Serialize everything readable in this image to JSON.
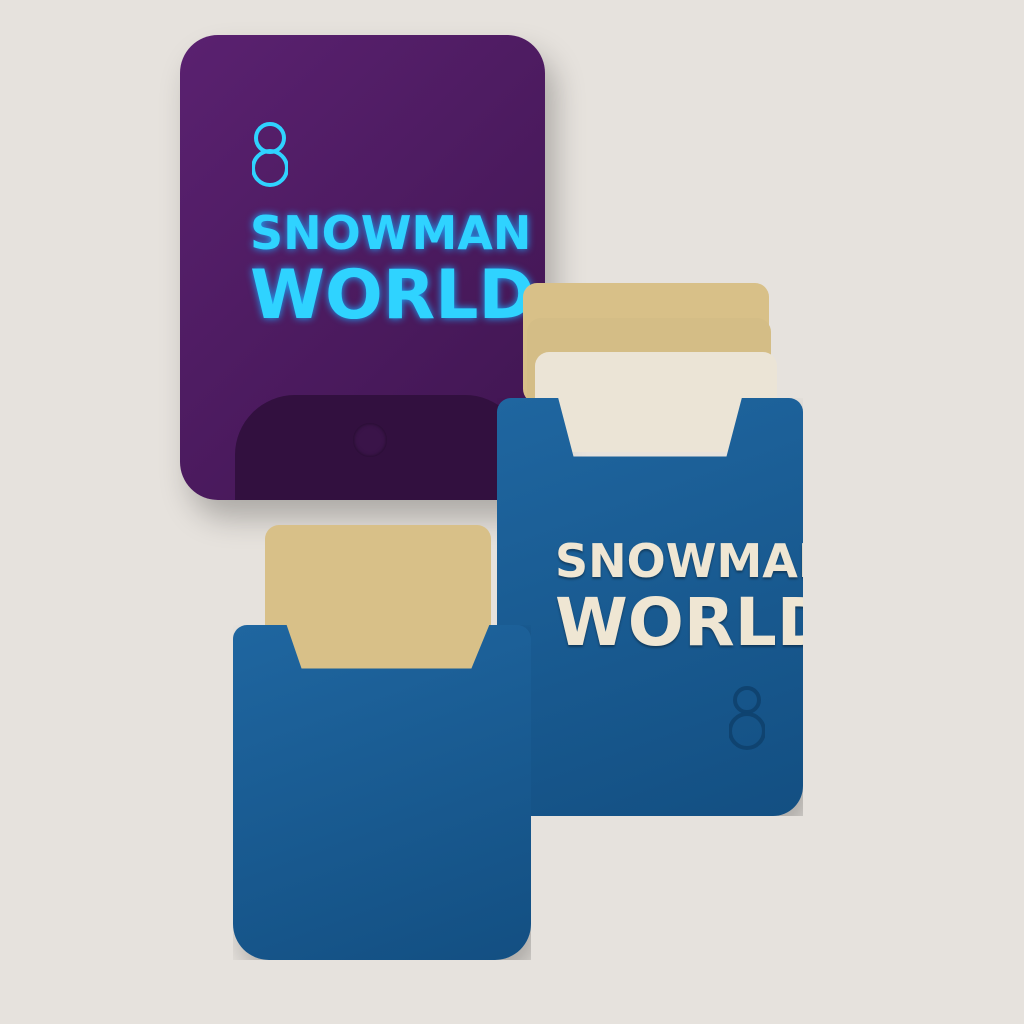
{
  "purple_box": {
    "title_line1": "SNOWMAN",
    "title_line2": "WORLD",
    "icon": "snowman-icon",
    "color": "#4a1a5e",
    "text_color": "#2fd3ff"
  },
  "blue_box_right": {
    "title_line1": "SNOWMAN",
    "title_line2": "WORLD",
    "icon": "snowman-icon",
    "color": "#1a5f96",
    "text_color": "#efe6d3"
  },
  "blue_box_left": {
    "color": "#165a8e"
  },
  "card_colors": [
    "#d8c088",
    "#ebe4d6"
  ]
}
